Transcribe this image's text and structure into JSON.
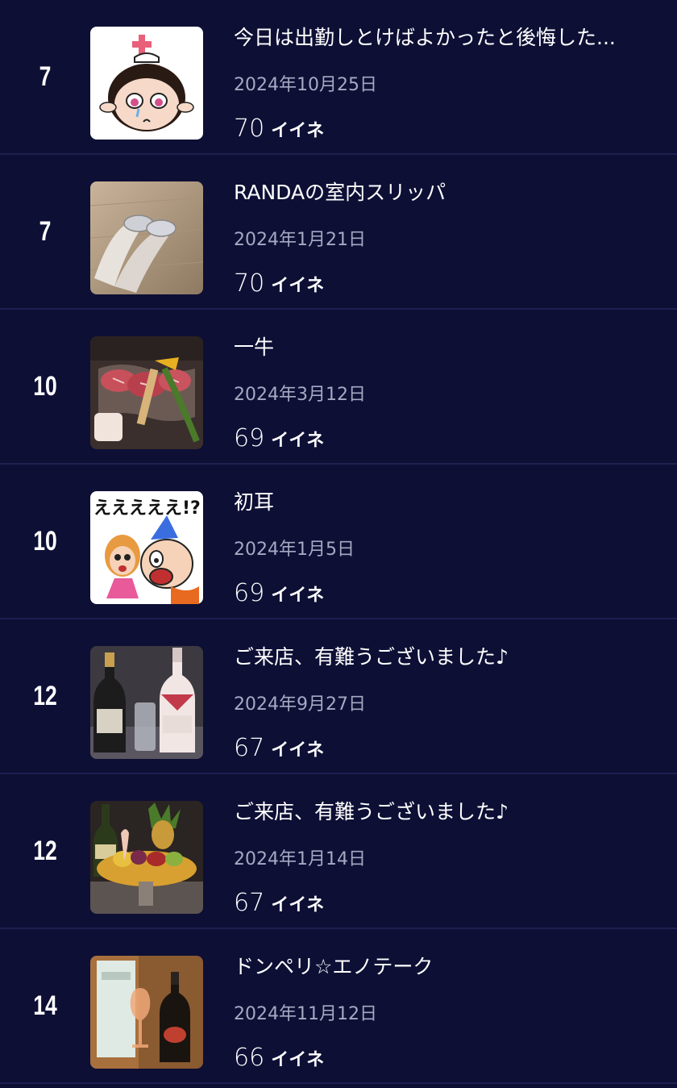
{
  "ranking": [
    {
      "rank": "7",
      "title": "今日は出勤しとけばよかったと後悔した...",
      "date": "2024年10月25日",
      "likes": "70",
      "likes_unit": "イイネ",
      "thumbnail": "crying-cartoon-girl"
    },
    {
      "rank": "7",
      "title": "RANDAの室内スリッパ",
      "date": "2024年1月21日",
      "likes": "70",
      "likes_unit": "イイネ",
      "thumbnail": "slippers-on-floor"
    },
    {
      "rank": "10",
      "title": "一牛",
      "date": "2024年3月12日",
      "likes": "69",
      "likes_unit": "イイネ",
      "thumbnail": "wagyu-beef-platter"
    },
    {
      "rank": "10",
      "title": "初耳",
      "date": "2024年1月5日",
      "likes": "69",
      "likes_unit": "イイネ",
      "thumbnail": "surprised-cartoon"
    },
    {
      "rank": "12",
      "title": "ご来店、有難うございました♪",
      "date": "2024年9月27日",
      "likes": "67",
      "likes_unit": "イイネ",
      "thumbnail": "champagne-bottles"
    },
    {
      "rank": "12",
      "title": "ご来店、有難うございました♪",
      "date": "2024年1月14日",
      "likes": "67",
      "likes_unit": "イイネ",
      "thumbnail": "fruit-platter"
    },
    {
      "rank": "14",
      "title": "ドンペリ☆エノテーク",
      "date": "2024年11月12日",
      "likes": "66",
      "likes_unit": "イイネ",
      "thumbnail": "dom-perignon-bottle"
    }
  ],
  "thumb4_caption": "えええええ!?",
  "colors": {
    "background": "#0d0f35",
    "divider": "#1d2150",
    "date_text": "#a6a9c2",
    "text": "#ffffff"
  }
}
